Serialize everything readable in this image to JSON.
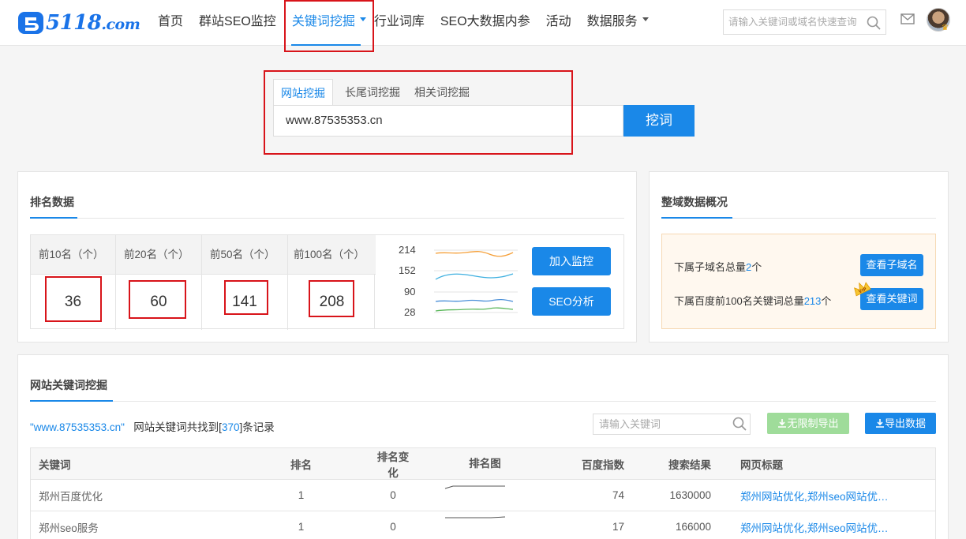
{
  "header": {
    "logo_text": "5118",
    "logo_suffix": ".com",
    "nav": [
      {
        "label": "首页"
      },
      {
        "label": "群站SEO监控"
      },
      {
        "label": "关键词挖掘",
        "active": true,
        "dropdown": true
      },
      {
        "label": "行业词库"
      },
      {
        "label": "SEO大数据内参"
      },
      {
        "label": "活动"
      },
      {
        "label": "数据服务",
        "dropdown": true
      }
    ],
    "search_placeholder": "请输入关键词或域名快速查询",
    "icons": [
      "search-icon",
      "mail-icon",
      "avatar"
    ]
  },
  "miner": {
    "tabs": [
      "网站挖掘",
      "长尾词挖掘",
      "相关词挖掘"
    ],
    "active_tab": 0,
    "input_value": "www.87535353.cn",
    "button": "挖词"
  },
  "ranking": {
    "title": "排名数据",
    "headers": [
      "前10名（个）",
      "前20名（个）",
      "前50名（个）",
      "前100名（个）"
    ],
    "values": [
      "36",
      "60",
      "141",
      "208"
    ],
    "axis_labels": [
      "214",
      "152",
      "90",
      "28"
    ],
    "btn_monitor": "加入监控",
    "btn_seo": "SEO分析",
    "series_colors": [
      "#f5a03a",
      "#3fb0e0",
      "#4a8fd8",
      "#5cb85c"
    ]
  },
  "domain": {
    "title": "整域数据概况",
    "sub_label_pre": "下属子域名总量",
    "sub_count": "2",
    "sub_label_post": "个",
    "kw_label_pre": "下属百度前100名关键词总量",
    "kw_count": "213",
    "kw_label_post": "个",
    "btn_sub": "查看子域名",
    "btn_kw": "查看关键词",
    "vip_badge": "VIP"
  },
  "keywords": {
    "title": "网站关键词挖掘",
    "summary_domain": "\"www.87535353.cn\"",
    "summary_pre": "网站关键词共找到[",
    "summary_count": "370",
    "summary_post": "]条记录",
    "search_placeholder": "请输入关键词",
    "btn_unlimited": "无限制导出",
    "btn_export": "导出数据",
    "columns": [
      "关键词",
      "排名",
      "排名变化",
      "排名图",
      "百度指数",
      "搜索结果",
      "网页标题"
    ],
    "rows": [
      {
        "keyword": "郑州百度优化",
        "rank": "1",
        "change": "0",
        "index": "74",
        "results": "1630000",
        "title": "郑州网站优化,郑州seo网站优化_..."
      },
      {
        "keyword": "郑州seo服务",
        "rank": "1",
        "change": "0",
        "index": "17",
        "results": "166000",
        "title": "郑州网站优化,郑州seo网站优化_..."
      }
    ]
  },
  "colors": {
    "accent": "#1a88e8",
    "highlight_box": "#d8141a",
    "export_disabled": "#9fdc9a"
  }
}
